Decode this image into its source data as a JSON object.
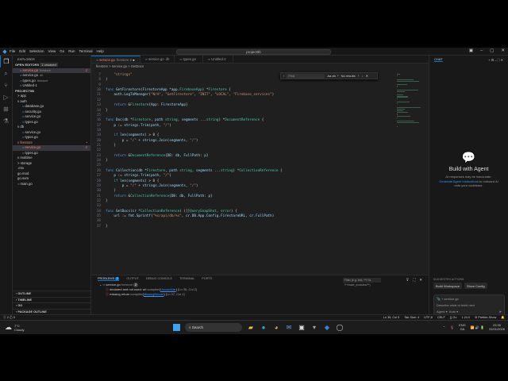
{
  "titlebar": {
    "menu": [
      "File",
      "Edit",
      "Selection",
      "View",
      "Go",
      "Run",
      "Terminal",
      "Help"
    ],
    "search": "project0b"
  },
  "sidebar": {
    "title": "EXPLORER",
    "open_editors": "OPEN EDITORS",
    "unsaved": "1 unsaved",
    "open": [
      {
        "name": "service.go",
        "desc": "firestore",
        "badge": "2",
        "sel": true,
        "red": true
      },
      {
        "name": "service.go",
        "desc": "db"
      },
      {
        "name": "types.go",
        "desc": "firestore"
      },
      {
        "name": "Untitled-1",
        "desc": ""
      }
    ],
    "project": "PROJECT0B",
    "tree": [
      {
        "t": "> app",
        "d": 1
      },
      {
        "t": "v auth",
        "d": 1
      },
      {
        "t": "database.go",
        "d": 2,
        "go": 1
      },
      {
        "t": "security.go",
        "d": 2,
        "go": 1
      },
      {
        "t": "service.go",
        "d": 2,
        "go": 1
      },
      {
        "t": "types.go",
        "d": 2,
        "go": 1
      },
      {
        "t": "v db",
        "d": 1
      },
      {
        "t": "service.go",
        "d": 2,
        "go": 1
      },
      {
        "t": "types.go",
        "d": 2,
        "go": 1
      },
      {
        "t": "v firestore",
        "d": 1,
        "red": 1,
        "badge": "•"
      },
      {
        "t": "service.go",
        "d": 2,
        "go": 1,
        "red": 1,
        "sel": 1,
        "badge": "2"
      },
      {
        "t": "types.go",
        "d": 2,
        "go": 1
      },
      {
        "t": "v realtime",
        "d": 1
      },
      {
        "t": "> storage",
        "d": 1
      },
      {
        "t": ".env",
        "d": 1
      },
      {
        "t": "go.mod",
        "d": 1
      },
      {
        "t": "go.sum",
        "d": 1
      },
      {
        "t": "main.go",
        "d": 1,
        "go": 1
      }
    ],
    "outline": [
      "OUTLINE",
      "TIMELINE",
      "GO",
      "PACKAGE OUTLINE"
    ]
  },
  "tabs": [
    {
      "label": "service.go",
      "desc": "firestore 2",
      "active": true
    },
    {
      "label": "service.go",
      "desc": "db"
    },
    {
      "label": "types.go",
      "desc": ""
    },
    {
      "label": "Untitled-1",
      "desc": ""
    }
  ],
  "breadcrumb": "firestore > service.go > GetDocs",
  "find": {
    "placeholder": "Find",
    "options": "Aa ab .*",
    "result": "No results"
  },
  "code": [
    [
      7,
      "\t\"strings\""
    ],
    [
      8,
      ")"
    ],
    [
      9,
      ""
    ],
    [
      10,
      "func GetFirestore(FirestoreApp *app.FirebaseApp) *Firestore {"
    ],
    [
      11,
      "\tauth.LogToManager(\"N/A\", \"GetFirestore\", \"INIT\", \"LOCAL\", \"Firebase_services\")"
    ],
    [
      12,
      ""
    ],
    [
      13,
      "\treturn &Firestore{App: FirestoreApp}"
    ],
    [
      14,
      "}"
    ],
    [
      15,
      ""
    ],
    [
      16,
      "func Doc(db *Firestore, path string, segments ...string) *DocumentReference {"
    ],
    [
      17,
      "\tp := strings.Trim(path, \"/\")"
    ],
    [
      18,
      ""
    ],
    [
      19,
      "\tif len(segments) > 0 {"
    ],
    [
      20,
      "\t\tp = \"/\" + strings.Join(segments, \"/\")"
    ],
    [
      21,
      "\t}"
    ],
    [
      22,
      ""
    ],
    [
      23,
      "\treturn &DocumentReference{DB: db, FullPath: p}"
    ],
    [
      24,
      "}"
    ],
    [
      25,
      ""
    ],
    [
      26,
      "func Collection(db *Firestore, path string, segments ...string) *CollectionReference {"
    ],
    [
      27,
      "\tp := strings.Trim(path, \"/\")"
    ],
    [
      28,
      "\tif len(segments) > 0 {"
    ],
    [
      29,
      "\t\tp = \"/\" + strings.Join(segments, \"/\")"
    ],
    [
      30,
      "\t}"
    ],
    [
      31,
      "\treturn &CollectionReference{DB: db, FullPath: p}"
    ],
    [
      32,
      "}"
    ],
    [
      33,
      ""
    ],
    [
      34,
      "func GetDocs(cr *CollectionReference) ([]QuerySnapShot, error) {"
    ],
    [
      35,
      "\turl := fmt.Sprintf(\"%s/api/db/%s\", cr.DB.App.Config.FirestoreURL, cr.FullPath)"
    ],
    [
      36,
      ""
    ],
    [
      37,
      "}"
    ]
  ],
  "panel": {
    "tabs": [
      "PROBLEMS",
      "OUTPUT",
      "DEBUG CONSOLE",
      "TERMINAL",
      "PORTS"
    ],
    "count": "2",
    "file": "service.go",
    "folder": "firestore",
    "filter": "Filter (e.g. text, **/*.ts, !**/node_modules/**)",
    "problems": [
      {
        "msg": "declared and not used: url",
        "src": "compiler",
        "code": "UnusedVar",
        "loc": "[Ln 35, Col 2]"
      },
      {
        "msg": "missing return",
        "src": "compiler",
        "code": "MissingReturn",
        "loc": "[Ln 37, Col 1]"
      }
    ]
  },
  "chat": {
    "title": "CHAT",
    "heading": "Build with Agent",
    "note": "AI responses may be inaccurate.",
    "link": "Generate Agent Instructions",
    "note2": "to onboard AI onto your codebase.",
    "suggested": "SUGGESTED ACTIONS",
    "actions": [
      "Build Workspace",
      "Show Config"
    ],
    "context": "service.go",
    "placeholder": "Describe what to build next",
    "mode": "Agent",
    "model": "Auto"
  },
  "status": {
    "errors": "2",
    "warnings": "0",
    "position": "Ln 35, Col 5",
    "tab": "Tab Size: 4",
    "enc": "UTF-8",
    "eol": "CRLF",
    "lang": "Go",
    "ver": "1.24.0",
    "ext": "Prettier-Show"
  },
  "taskbar": {
    "temp": "7°C",
    "weather": "Cloudy",
    "search": "Search",
    "lang": "ENG",
    "region": "GA",
    "time": "23:30",
    "date": "31/01/2026"
  }
}
